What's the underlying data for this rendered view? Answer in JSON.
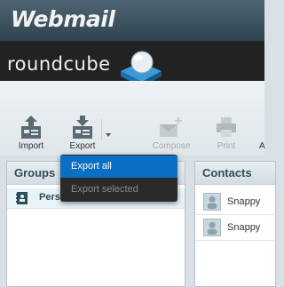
{
  "header": {
    "brand": "Webmail",
    "logo_text": "roundcube"
  },
  "toolbar": {
    "import_label": "Import",
    "export_label": "Export",
    "compose_label": "Compose",
    "print_label": "Print",
    "more_label": "A"
  },
  "export_menu": {
    "items": [
      {
        "label": "Export all",
        "state": "active"
      },
      {
        "label": "Export selected",
        "state": "disabled"
      }
    ]
  },
  "groups_panel": {
    "title": "Groups",
    "items": [
      {
        "label": "Personal Addresses"
      }
    ]
  },
  "contacts_panel": {
    "title": "Contacts",
    "items": [
      {
        "name": "Snappy"
      },
      {
        "name": "Snappy"
      }
    ]
  },
  "colors": {
    "accent": "#0b70c4",
    "header_bg": "#3d5563",
    "menu_bg": "#2a2a2a"
  }
}
